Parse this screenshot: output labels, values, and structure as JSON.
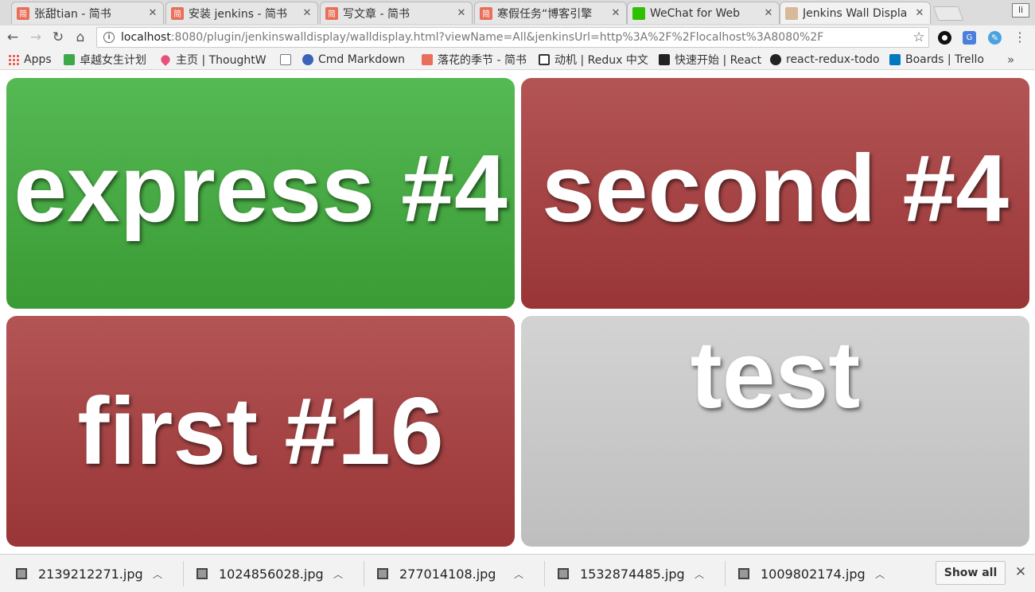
{
  "tabs": [
    {
      "title": "张甜tian - 简书",
      "icon": "jianshu-icon",
      "active": false
    },
    {
      "title": "安装 jenkins - 简书",
      "icon": "jianshu-icon",
      "active": false
    },
    {
      "title": "写文章 - 简书",
      "icon": "jianshu-icon",
      "active": false
    },
    {
      "title": "寒假任务“博客引擎",
      "icon": "jianshu-icon",
      "active": false
    },
    {
      "title": "WeChat for Web",
      "icon": "wechat-icon",
      "active": false
    },
    {
      "title": "Jenkins Wall Displa",
      "icon": "jenkins-icon",
      "active": true
    }
  ],
  "profile_label": "li",
  "address": {
    "host": "localhost",
    "rest": ":8080/plugin/jenkinswalldisplay/walldisplay.html?viewName=All&jenkinsUrl=http%3A%2F%2Flocalhost%3A8080%2F"
  },
  "bookmarks": [
    {
      "label": "Apps",
      "icon": "apps-grid-icon"
    },
    {
      "label": "卓越女生计划",
      "icon": "green-square-icon"
    },
    {
      "label": "主页 | ThoughtW",
      "icon": "heart-icon"
    },
    {
      "label": "",
      "icon": "document-icon"
    },
    {
      "label": "Cmd Markdown",
      "icon": "cmd-icon"
    },
    {
      "label": "落花的季节 - 简书",
      "icon": "jianshu-icon"
    },
    {
      "label": "动机 | Redux 中文",
      "icon": "book-icon"
    },
    {
      "label": "快速开始 | React",
      "icon": "react-icon"
    },
    {
      "label": "react-redux-todo",
      "icon": "github-icon"
    },
    {
      "label": "Boards | Trello",
      "icon": "trello-icon"
    }
  ],
  "jobs": [
    {
      "name": "express #4",
      "status": "success",
      "color": "#4caf50"
    },
    {
      "name": "second #4",
      "status": "failure",
      "color": "#a54244"
    },
    {
      "name": "first #16",
      "status": "failure",
      "color": "#a54244"
    },
    {
      "name": "test",
      "status": "disabled",
      "color": "#c8c8c8"
    }
  ],
  "downloads": [
    {
      "filename": "2139212271.jpg"
    },
    {
      "filename": "1024856028.jpg"
    },
    {
      "filename": "277014108.jpg"
    },
    {
      "filename": "1532874485.jpg"
    },
    {
      "filename": "1009802174.jpg"
    }
  ],
  "show_all_label": "Show all"
}
